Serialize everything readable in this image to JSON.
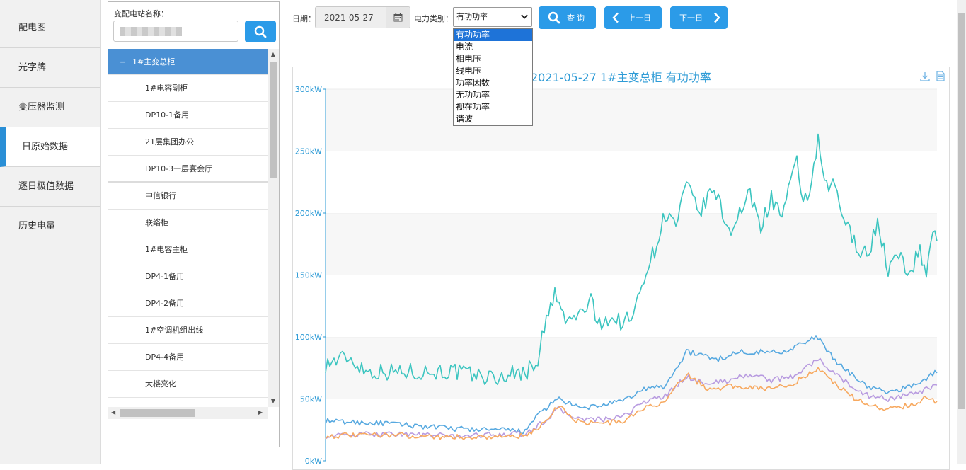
{
  "nav": {
    "items": [
      {
        "label": "配电图",
        "active": false
      },
      {
        "label": "光字牌",
        "active": false
      },
      {
        "label": "变压器监测",
        "active": false
      },
      {
        "label": "日原始数据",
        "active": true
      },
      {
        "label": "逐日极值数据",
        "active": false
      },
      {
        "label": "历史电量",
        "active": false
      }
    ]
  },
  "station": {
    "label": "变配电站名称：",
    "input_value": "",
    "search_icon": "search-icon",
    "tree": [
      {
        "label": "1#主变总柜",
        "root": true,
        "expanded_symbol": "−"
      },
      {
        "label": "1#电容副柜"
      },
      {
        "label": "DP10-1备用"
      },
      {
        "label": "21层集团办公"
      },
      {
        "label": "DP10-3一层宴会厅"
      },
      {
        "label": "中信银行"
      },
      {
        "label": "联络柜"
      },
      {
        "label": "1#电容主柜"
      },
      {
        "label": "DP4-1备用"
      },
      {
        "label": "DP4-2备用"
      },
      {
        "label": "1#空调机组出线"
      },
      {
        "label": "DP4-4备用"
      },
      {
        "label": "大楼亮化"
      }
    ]
  },
  "toolbar": {
    "date_label": "日期：",
    "date_value": "2021-05-27",
    "type_label": "电力类别：",
    "type_value": "有功功率",
    "query_label": "查 询",
    "prev_label": "上一日",
    "next_label": "下一日"
  },
  "dropdown": {
    "options": [
      "有功功率",
      "电流",
      "相电压",
      "线电压",
      "功率因数",
      "无功功率",
      "视在功率",
      "谐波"
    ],
    "selected": 0
  },
  "chart_data": {
    "type": "line",
    "title": "2021-05-27  1#主变总柜  有功功率",
    "ylabel": "",
    "xlabel": "",
    "y_unit": "kW",
    "ylim": [
      0,
      300
    ],
    "yticks": [
      "300kW",
      "250kW",
      "200kW",
      "150kW",
      "100kW",
      "50kW",
      "0kW"
    ],
    "grid": "horizontal-bands",
    "x_points": 288,
    "series": [
      {
        "color": "#3cc5c0",
        "keyframes": [
          [
            0,
            78
          ],
          [
            10,
            84
          ],
          [
            20,
            72
          ],
          [
            60,
            72
          ],
          [
            82,
            66
          ],
          [
            85,
            70
          ],
          [
            95,
            72
          ],
          [
            100,
            82
          ],
          [
            102,
            100
          ],
          [
            108,
            135
          ],
          [
            113,
            112
          ],
          [
            120,
            118
          ],
          [
            125,
            130
          ],
          [
            128,
            110
          ],
          [
            132,
            115
          ],
          [
            140,
            112
          ],
          [
            145,
            116
          ],
          [
            150,
            150
          ],
          [
            155,
            170
          ],
          [
            160,
            200
          ],
          [
            165,
            190
          ],
          [
            170,
            222
          ],
          [
            176,
            200
          ],
          [
            183,
            220
          ],
          [
            190,
            185
          ],
          [
            200,
            215
          ],
          [
            205,
            190
          ],
          [
            210,
            212
          ],
          [
            215,
            198
          ],
          [
            222,
            240
          ],
          [
            225,
            210
          ],
          [
            229,
            220
          ],
          [
            232,
            260
          ],
          [
            235,
            220
          ],
          [
            240,
            222
          ],
          [
            245,
            190
          ],
          [
            250,
            175
          ],
          [
            255,
            165
          ],
          [
            260,
            192
          ],
          [
            265,
            155
          ],
          [
            270,
            165
          ],
          [
            275,
            152
          ],
          [
            280,
            170
          ],
          [
            283,
            150
          ],
          [
            286,
            188
          ],
          [
            288,
            180
          ]
        ]
      },
      {
        "color": "#57a9e0",
        "keyframes": [
          [
            0,
            32
          ],
          [
            30,
            30
          ],
          [
            60,
            26
          ],
          [
            95,
            24
          ],
          [
            100,
            38
          ],
          [
            110,
            50
          ],
          [
            120,
            42
          ],
          [
            130,
            45
          ],
          [
            140,
            48
          ],
          [
            150,
            58
          ],
          [
            160,
            60
          ],
          [
            170,
            88
          ],
          [
            178,
            85
          ],
          [
            185,
            82
          ],
          [
            195,
            88
          ],
          [
            205,
            88
          ],
          [
            215,
            88
          ],
          [
            225,
            95
          ],
          [
            232,
            100
          ],
          [
            240,
            80
          ],
          [
            248,
            70
          ],
          [
            255,
            60
          ],
          [
            265,
            55
          ],
          [
            275,
            60
          ],
          [
            282,
            65
          ],
          [
            288,
            73
          ]
        ]
      },
      {
        "color": "#b89be0",
        "keyframes": [
          [
            0,
            20
          ],
          [
            30,
            22
          ],
          [
            60,
            20
          ],
          [
            95,
            22
          ],
          [
            100,
            28
          ],
          [
            110,
            42
          ],
          [
            118,
            34
          ],
          [
            130,
            33
          ],
          [
            140,
            35
          ],
          [
            150,
            48
          ],
          [
            160,
            52
          ],
          [
            170,
            68
          ],
          [
            180,
            62
          ],
          [
            190,
            65
          ],
          [
            200,
            70
          ],
          [
            210,
            65
          ],
          [
            220,
            68
          ],
          [
            232,
            82
          ],
          [
            240,
            70
          ],
          [
            248,
            60
          ],
          [
            255,
            53
          ],
          [
            265,
            50
          ],
          [
            275,
            53
          ],
          [
            282,
            57
          ],
          [
            288,
            60
          ]
        ]
      },
      {
        "color": "#f7a960",
        "keyframes": [
          [
            0,
            20
          ],
          [
            30,
            21
          ],
          [
            60,
            19
          ],
          [
            95,
            20
          ],
          [
            100,
            26
          ],
          [
            110,
            45
          ],
          [
            118,
            32
          ],
          [
            130,
            30
          ],
          [
            140,
            32
          ],
          [
            150,
            42
          ],
          [
            160,
            48
          ],
          [
            170,
            70
          ],
          [
            180,
            58
          ],
          [
            190,
            60
          ],
          [
            200,
            60
          ],
          [
            210,
            58
          ],
          [
            220,
            62
          ],
          [
            232,
            75
          ],
          [
            240,
            62
          ],
          [
            248,
            52
          ],
          [
            255,
            45
          ],
          [
            265,
            42
          ],
          [
            275,
            45
          ],
          [
            282,
            50
          ],
          [
            288,
            48
          ]
        ]
      }
    ]
  }
}
